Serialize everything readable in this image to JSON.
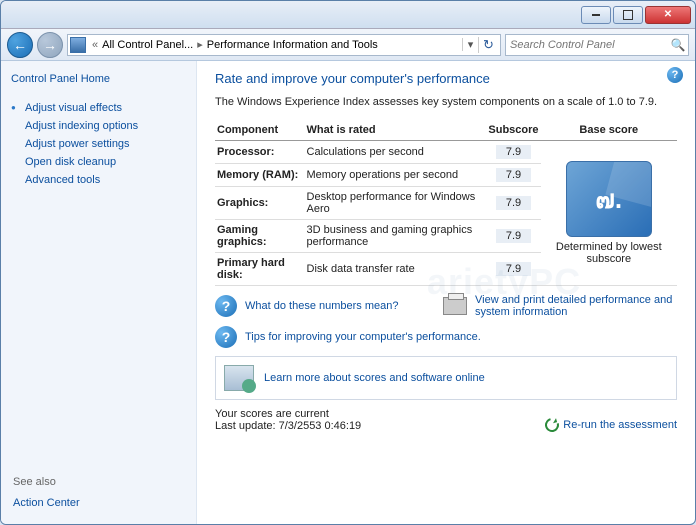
{
  "titlebar": {},
  "nav": {
    "breadcrumb_root": "All Control Panel...",
    "breadcrumb_current": "Performance Information and Tools",
    "search_placeholder": "Search Control Panel"
  },
  "sidebar": {
    "home": "Control Panel Home",
    "links": {
      "visual": "Adjust visual effects",
      "indexing": "Adjust indexing options",
      "power": "Adjust power settings",
      "cleanup": "Open disk cleanup",
      "advanced": "Advanced tools"
    },
    "seealso_label": "See also",
    "seealso_link": "Action Center"
  },
  "main": {
    "title": "Rate and improve your computer's performance",
    "desc": "The Windows Experience Index assesses key system components on a scale of 1.0 to 7.9.",
    "headers": {
      "component": "Component",
      "rated": "What is rated",
      "subscore": "Subscore",
      "basescore": "Base score"
    },
    "rows": {
      "processor": {
        "name": "Processor:",
        "rated": "Calculations per second",
        "sub": "7.9"
      },
      "memory": {
        "name": "Memory (RAM):",
        "rated": "Memory operations per second",
        "sub": "7.9"
      },
      "graphics": {
        "name": "Graphics:",
        "rated": "Desktop performance for Windows Aero",
        "sub": "7.9"
      },
      "gaming": {
        "name": "Gaming graphics:",
        "rated": "3D business and gaming graphics performance",
        "sub": "7.9"
      },
      "disk": {
        "name": "Primary hard disk:",
        "rated": "Disk data transfer rate",
        "sub": "7.9"
      }
    },
    "base_value": "๗.",
    "base_label": "Determined by lowest subscore",
    "links": {
      "numbers": "What do these numbers mean?",
      "detailed": "View and print detailed performance and system information",
      "tips": "Tips for improving your computer's performance.",
      "learnmore": "Learn more about scores and software online"
    },
    "footer": {
      "current": "Your scores are current",
      "updated": "Last update: 7/3/2553 0:46:19",
      "rerun": "Re-run the assessment"
    }
  }
}
